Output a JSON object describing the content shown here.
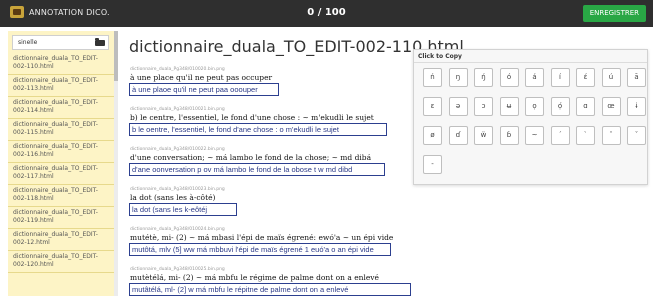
{
  "topbar": {
    "brand_label": "ANNOTATION DICO.",
    "counter": "0 / 100",
    "save_label": "ENREGISTRER"
  },
  "sidebar": {
    "search_value": "sinelle",
    "items": [
      "dictionnaire_duala_TO_EDIT-002-110.html",
      "dictionnaire_duala_TO_EDIT-002-113.html",
      "dictionnaire_duala_TO_EDIT-002-114.html",
      "dictionnaire_duala_TO_EDIT-002-115.html",
      "dictionnaire_duala_TO_EDIT-002-116.html",
      "dictionnaire_duala_TO_EDIT-002-117.html",
      "dictionnaire_duala_TO_EDIT-002-118.html",
      "dictionnaire_duala_TO_EDIT-002-119.html",
      "dictionnaire_duala_TO_EDIT-002-12.html",
      "dictionnaire_duala_TO_EDIT-002-120.html"
    ]
  },
  "main": {
    "title": "dictionnaire_duala_TO_EDIT-002-110.html",
    "entries": [
      {
        "file": "dictionnaire_duala_Pg348/010020.bin.png",
        "scan": "à une place qu'il ne peut pas occuper",
        "value": "à une plaoe qu'il ne peut paa ooouper"
      },
      {
        "file": "dictionnaire_duala_Pg348/010021.bin.png",
        "scan": "b) le centre, l'essentiel, le fond d'une chose : ~ m'ekudli le sujet",
        "value": "b le oentre, l'essentiel, le fond d'ane chose : o m'ekudli le sujet"
      },
      {
        "file": "dictionnaire_duala_Pg348/010022.bin.png",
        "scan": "d'une conversation; ~ má lambo le fond de la chose; ~ md dibá",
        "value": "d'ane oonversation p ov má lambo le fond de la obose t w md dibd"
      },
      {
        "file": "dictionnaire_duala_Pg348/010023.bin.png",
        "scan": "la dot (sans les à-côté)",
        "value": "la dot (sans les k-eôtéj"
      },
      {
        "file": "dictionnaire_duala_Pg348/010024.bin.png",
        "scan": "mutétè, mi- (2)   ~ má mbasi l'épi de maïs égrené: ewó'a ~ un épi vide",
        "value": "mutôtá, mlv (5] ww má mbbuvi l'épi de maïs égrené 1 euó'a o an épi vide"
      },
      {
        "file": "dictionnaire_duala_Pg348/010025.bin.png",
        "scan": "mutètélá, mi- (2)   ~ má mbfu le régime de palme dont on a enlevé",
        "value": "mutâtélá, ml- (2] w má mbfu le répitne de palme dont on a enlevé"
      }
    ]
  },
  "click_to_copy": {
    "title": "Click to Copy",
    "rows": [
      [
        "ń",
        "ŋ",
        "ŋ́",
        "ó",
        "á",
        "í",
        "ɛ́",
        "ú",
        "ā"
      ],
      [
        "ɛ",
        "ə",
        "ɔ",
        "ʉ",
        "ọ",
        "ọ́",
        "ɑ",
        "œ",
        "ɨ"
      ],
      [
        "ø",
        "ɗ",
        "ẅ",
        "ɓ",
        "~",
        "´",
        "`",
        "ˆ",
        "ˇ"
      ],
      [
        "-"
      ]
    ]
  }
}
